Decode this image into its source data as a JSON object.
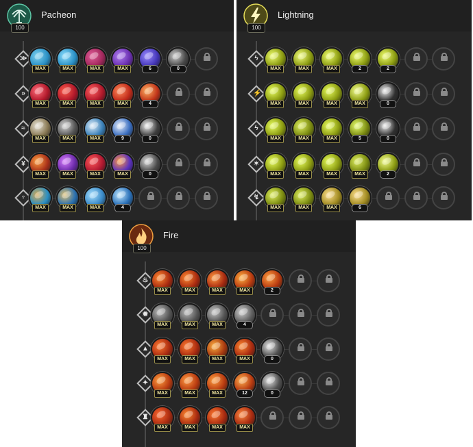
{
  "panels": [
    {
      "id": "pacheon",
      "title": "Pacheon",
      "level": "100",
      "accent": "#3fa889",
      "emblem": "pacheon-emblem-icon",
      "rows": [
        {
          "icon": "arrow-chevron-icon",
          "glyph": "≫",
          "nodes": [
            {
              "c": "#2a8fc4",
              "h": "#7fd3f0",
              "b": "MAX"
            },
            {
              "c": "#2a8fc4",
              "h": "#8fe0ff",
              "b": "MAX"
            },
            {
              "c": "#a2275c",
              "h": "#e25f9a",
              "b": "MAX"
            },
            {
              "c": "#6a2fb0",
              "h": "#b07ff0",
              "b": "MAX"
            },
            {
              "c": "#4436b8",
              "h": "#9a8bff",
              "b": "6"
            },
            {
              "c": "#4a4a4a",
              "h": "#cfcfcf",
              "b": "0"
            },
            {
              "locked": true
            }
          ]
        },
        {
          "icon": "double-chevron-icon",
          "glyph": "»",
          "nodes": [
            {
              "c": "#b0182a",
              "h": "#ff6c7a",
              "b": "MAX"
            },
            {
              "c": "#b0182a",
              "h": "#ff5a4a",
              "b": "MAX"
            },
            {
              "c": "#b0182a",
              "h": "#ff6060",
              "b": "MAX"
            },
            {
              "c": "#c02a1a",
              "h": "#ff8a5a",
              "b": "MAX"
            },
            {
              "c": "#c0341a",
              "h": "#ffb060",
              "b": "4"
            },
            {
              "locked": true
            },
            {
              "locked": true
            }
          ]
        },
        {
          "icon": "feather-icon",
          "glyph": "≈",
          "nodes": [
            {
              "c": "#8a7a55",
              "h": "#e8e4d8",
              "b": "MAX"
            },
            {
              "c": "#555555",
              "h": "#d8d8d8",
              "b": "MAX"
            },
            {
              "c": "#3a80b8",
              "h": "#dfeefa",
              "b": "MAX"
            },
            {
              "c": "#3a6ec0",
              "h": "#e8eefa",
              "b": "9"
            },
            {
              "c": "#404040",
              "h": "#f2f2f2",
              "b": "0"
            },
            {
              "locked": true
            },
            {
              "locked": true
            }
          ]
        },
        {
          "icon": "claw-icon",
          "glyph": "¥",
          "nodes": [
            {
              "c": "#a8301a",
              "h": "#ffa040",
              "b": "MAX"
            },
            {
              "c": "#6a2aa8",
              "h": "#d87cff",
              "b": "MAX"
            },
            {
              "c": "#b01830",
              "h": "#ff5a5a",
              "b": "MAX"
            },
            {
              "c": "#5a30c0",
              "h": "#ff9a40",
              "b": "MAX"
            },
            {
              "c": "#4a4a4a",
              "h": "#dcdcdc",
              "b": "0"
            },
            {
              "locked": true
            },
            {
              "locked": true
            }
          ]
        },
        {
          "icon": "talon-icon",
          "glyph": "♆",
          "nodes": [
            {
              "c": "#2a8fc4",
              "h": "#d8a850",
              "b": "MAX"
            },
            {
              "c": "#2a70b0",
              "h": "#e0c070",
              "b": "MAX"
            },
            {
              "c": "#3a8ac8",
              "h": "#a8e0ff",
              "b": "MAX"
            },
            {
              "c": "#2a70b8",
              "h": "#c0e8ff",
              "b": "4"
            },
            {
              "locked": true
            },
            {
              "locked": true
            },
            {
              "locked": true
            }
          ]
        }
      ]
    },
    {
      "id": "lightning",
      "title": "Lightning",
      "level": "100",
      "accent": "#d4d040",
      "emblem": "lightning-emblem-icon",
      "rows": [
        {
          "icon": "bolt-slash-icon",
          "glyph": "ϟ",
          "nodes": [
            {
              "c": "#8a9a10",
              "h": "#f0ff70",
              "b": "MAX"
            },
            {
              "c": "#8a9a10",
              "h": "#f4ff80",
              "b": "MAX"
            },
            {
              "c": "#8a9a10",
              "h": "#f0ff70",
              "b": "MAX"
            },
            {
              "c": "#8a9a10",
              "h": "#f0ff70",
              "b": "2"
            },
            {
              "c": "#8a9a10",
              "h": "#f0ff70",
              "b": "2"
            },
            {
              "locked": true
            },
            {
              "locked": true
            }
          ]
        },
        {
          "icon": "bolt-pair-icon",
          "glyph": "⚡",
          "nodes": [
            {
              "c": "#8a9a10",
              "h": "#eaff60",
              "b": "MAX"
            },
            {
              "c": "#8a9a10",
              "h": "#eaff60",
              "b": "MAX"
            },
            {
              "c": "#8a9a10",
              "h": "#eaff60",
              "b": "MAX"
            },
            {
              "c": "#8a9a10",
              "h": "#f4ff90",
              "b": "MAX"
            },
            {
              "c": "#303030",
              "h": "#f0f0f0",
              "b": "0"
            },
            {
              "locked": true
            },
            {
              "locked": true
            }
          ]
        },
        {
          "icon": "bolt-fork-icon",
          "glyph": "ϟ",
          "nodes": [
            {
              "c": "#8a9a10",
              "h": "#eaff60",
              "b": "MAX"
            },
            {
              "c": "#7a8a10",
              "h": "#e0f060",
              "b": "MAX"
            },
            {
              "c": "#8a9a10",
              "h": "#eaff60",
              "b": "MAX"
            },
            {
              "c": "#7a8a10",
              "h": "#e8ff70",
              "b": "5"
            },
            {
              "c": "#303030",
              "h": "#f0f0f0",
              "b": "0"
            },
            {
              "locked": true
            },
            {
              "locked": true
            }
          ]
        },
        {
          "icon": "bolt-burst-icon",
          "glyph": "✶",
          "nodes": [
            {
              "c": "#8a9a10",
              "h": "#eaff60",
              "b": "MAX"
            },
            {
              "c": "#8a9a10",
              "h": "#eaff60",
              "b": "MAX"
            },
            {
              "c": "#8a9a10",
              "h": "#eaff60",
              "b": "MAX"
            },
            {
              "c": "#7a8a10",
              "h": "#e0f060",
              "b": "MAX"
            },
            {
              "c": "#8a9a10",
              "h": "#f4ff90",
              "b": "2"
            },
            {
              "locked": true
            },
            {
              "locked": true
            }
          ]
        },
        {
          "icon": "bolt-strike-icon",
          "glyph": "↯",
          "nodes": [
            {
              "c": "#7a8a10",
              "h": "#e0f060",
              "b": "MAX"
            },
            {
              "c": "#7a8a10",
              "h": "#e0f060",
              "b": "MAX"
            },
            {
              "c": "#a08a20",
              "h": "#ffe090",
              "b": "MAX"
            },
            {
              "c": "#a08a20",
              "h": "#ffe090",
              "b": "6"
            },
            {
              "locked": true
            },
            {
              "locked": true
            },
            {
              "locked": true
            }
          ]
        }
      ]
    },
    {
      "id": "fire",
      "title": "Fire",
      "level": "100",
      "accent": "#e07a2a",
      "emblem": "fire-emblem-icon",
      "rows": [
        {
          "icon": "flame-icon",
          "glyph": "♨",
          "nodes": [
            {
              "c": "#a82a10",
              "h": "#ff8a30",
              "b": "MAX"
            },
            {
              "c": "#a82a10",
              "h": "#ff8a30",
              "b": "MAX"
            },
            {
              "c": "#a82a10",
              "h": "#ff9a40",
              "b": "MAX"
            },
            {
              "c": "#b83a10",
              "h": "#ffb040",
              "b": "MAX"
            },
            {
              "c": "#b83a10",
              "h": "#ffa040",
              "b": "2"
            },
            {
              "locked": true
            },
            {
              "locked": true
            }
          ]
        },
        {
          "icon": "flame-shield-icon",
          "glyph": "✹",
          "nodes": [
            {
              "c": "#555555",
              "h": "#bdbdbd",
              "b": "MAX"
            },
            {
              "c": "#555555",
              "h": "#bdbdbd",
              "b": "MAX"
            },
            {
              "c": "#555555",
              "h": "#c8c8c8",
              "b": "MAX"
            },
            {
              "c": "#606060",
              "h": "#d0d0d0",
              "b": "4"
            },
            {
              "locked": true
            },
            {
              "locked": true
            },
            {
              "locked": true
            }
          ]
        },
        {
          "icon": "flame-arrow-icon",
          "glyph": "▲",
          "nodes": [
            {
              "c": "#a82a10",
              "h": "#ff7a30",
              "b": "MAX"
            },
            {
              "c": "#a82a10",
              "h": "#ff7a30",
              "b": "MAX"
            },
            {
              "c": "#a83a10",
              "h": "#ffb040",
              "b": "MAX"
            },
            {
              "c": "#a82a10",
              "h": "#ff8a30",
              "b": "MAX"
            },
            {
              "c": "#505050",
              "h": "#e6e6e6",
              "b": "0"
            },
            {
              "locked": true
            },
            {
              "locked": true
            }
          ]
        },
        {
          "icon": "flame-crest-icon",
          "glyph": "✦",
          "nodes": [
            {
              "c": "#b83a10",
              "h": "#ffa040",
              "b": "MAX"
            },
            {
              "c": "#b83a10",
              "h": "#ff9a40",
              "b": "MAX"
            },
            {
              "c": "#b83a10",
              "h": "#ffa040",
              "b": "MAX"
            },
            {
              "c": "#b83a10",
              "h": "#ffb050",
              "b": "12"
            },
            {
              "c": "#505050",
              "h": "#e6e6e6",
              "b": "0"
            },
            {
              "locked": true
            },
            {
              "locked": true
            }
          ]
        },
        {
          "icon": "flame-tower-icon",
          "glyph": "♜",
          "nodes": [
            {
              "c": "#a82a10",
              "h": "#ff6a30",
              "b": "MAX"
            },
            {
              "c": "#a82a10",
              "h": "#ff8a30",
              "b": "MAX"
            },
            {
              "c": "#a82a10",
              "h": "#ff7a30",
              "b": "MAX"
            },
            {
              "c": "#a82a10",
              "h": "#ff8a40",
              "b": "MAX"
            },
            {
              "locked": true
            },
            {
              "locked": true
            },
            {
              "locked": true
            }
          ]
        }
      ]
    }
  ]
}
